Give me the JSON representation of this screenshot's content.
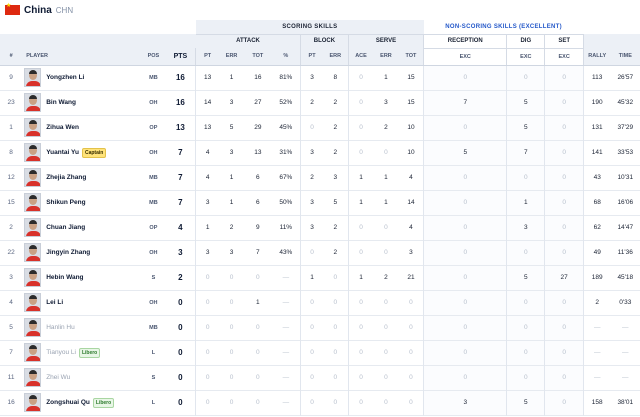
{
  "team": {
    "name": "China",
    "code": "CHN"
  },
  "headers": {
    "scoring": "SCORING SKILLS",
    "nonscoring": "NON-SCORING SKILLS (EXCELLENT)",
    "attack": "ATTACK",
    "block": "BLOCK",
    "serve": "SERVE",
    "reception": "RECEPTION",
    "dig": "DIG",
    "set": "SET",
    "num": "#",
    "player": "PLAYER",
    "pos": "POS",
    "pts": "PTS",
    "pt": "PT",
    "err": "ERR",
    "tot": "TOT",
    "pct": "%",
    "ace": "ACE",
    "exc": "EXC",
    "rally": "RALLY",
    "time": "TIME"
  },
  "players": [
    {
      "num": "9",
      "name": "Yongzhen Li",
      "badge": "",
      "pos": "MB",
      "pts": "16",
      "atk_pt": "13",
      "atk_err": "1",
      "atk_tot": "16",
      "atk_pct": "81%",
      "blk_pt": "3",
      "blk_err": "8",
      "srv_ace": "0",
      "srv_err": "1",
      "srv_tot": "15",
      "rec": "0",
      "dig": "0",
      "set": "0",
      "rally": "113",
      "time": "26'57",
      "active": true
    },
    {
      "num": "23",
      "name": "Bin Wang",
      "badge": "",
      "pos": "OH",
      "pts": "16",
      "atk_pt": "14",
      "atk_err": "3",
      "atk_tot": "27",
      "atk_pct": "52%",
      "blk_pt": "2",
      "blk_err": "2",
      "srv_ace": "0",
      "srv_err": "3",
      "srv_tot": "15",
      "rec": "7",
      "dig": "5",
      "set": "0",
      "rally": "190",
      "time": "45'32",
      "active": true
    },
    {
      "num": "1",
      "name": "Zihua Wen",
      "badge": "",
      "pos": "OP",
      "pts": "13",
      "atk_pt": "13",
      "atk_err": "5",
      "atk_tot": "29",
      "atk_pct": "45%",
      "blk_pt": "0",
      "blk_err": "2",
      "srv_ace": "0",
      "srv_err": "2",
      "srv_tot": "10",
      "rec": "0",
      "dig": "5",
      "set": "0",
      "rally": "131",
      "time": "37'29",
      "active": true
    },
    {
      "num": "8",
      "name": "Yuantai Yu",
      "badge": "Captain",
      "pos": "OH",
      "pts": "7",
      "atk_pt": "4",
      "atk_err": "3",
      "atk_tot": "13",
      "atk_pct": "31%",
      "blk_pt": "3",
      "blk_err": "2",
      "srv_ace": "0",
      "srv_err": "0",
      "srv_tot": "10",
      "rec": "5",
      "dig": "7",
      "set": "0",
      "rally": "141",
      "time": "33'53",
      "active": true
    },
    {
      "num": "12",
      "name": "Zhejia Zhang",
      "badge": "",
      "pos": "MB",
      "pts": "7",
      "atk_pt": "4",
      "atk_err": "1",
      "atk_tot": "6",
      "atk_pct": "67%",
      "blk_pt": "2",
      "blk_err": "3",
      "srv_ace": "1",
      "srv_err": "1",
      "srv_tot": "4",
      "rec": "0",
      "dig": "0",
      "set": "0",
      "rally": "43",
      "time": "10'31",
      "active": true
    },
    {
      "num": "15",
      "name": "Shikun Peng",
      "badge": "",
      "pos": "MB",
      "pts": "7",
      "atk_pt": "3",
      "atk_err": "1",
      "atk_tot": "6",
      "atk_pct": "50%",
      "blk_pt": "3",
      "blk_err": "5",
      "srv_ace": "1",
      "srv_err": "1",
      "srv_tot": "14",
      "rec": "0",
      "dig": "1",
      "set": "0",
      "rally": "68",
      "time": "16'06",
      "active": true
    },
    {
      "num": "2",
      "name": "Chuan Jiang",
      "badge": "",
      "pos": "OP",
      "pts": "4",
      "atk_pt": "1",
      "atk_err": "2",
      "atk_tot": "9",
      "atk_pct": "11%",
      "blk_pt": "3",
      "blk_err": "2",
      "srv_ace": "0",
      "srv_err": "0",
      "srv_tot": "4",
      "rec": "0",
      "dig": "3",
      "set": "0",
      "rally": "62",
      "time": "14'47",
      "active": true
    },
    {
      "num": "22",
      "name": "Jingyin Zhang",
      "badge": "",
      "pos": "OH",
      "pts": "3",
      "atk_pt": "3",
      "atk_err": "3",
      "atk_tot": "7",
      "atk_pct": "43%",
      "blk_pt": "0",
      "blk_err": "2",
      "srv_ace": "0",
      "srv_err": "0",
      "srv_tot": "3",
      "rec": "0",
      "dig": "0",
      "set": "0",
      "rally": "49",
      "time": "11'36",
      "active": true
    },
    {
      "num": "3",
      "name": "Hebin Wang",
      "badge": "",
      "pos": "S",
      "pts": "2",
      "atk_pt": "0",
      "atk_err": "0",
      "atk_tot": "0",
      "atk_pct": "—",
      "blk_pt": "1",
      "blk_err": "0",
      "srv_ace": "1",
      "srv_err": "2",
      "srv_tot": "21",
      "rec": "0",
      "dig": "5",
      "set": "27",
      "rally": "189",
      "time": "45'18",
      "active": true
    },
    {
      "num": "4",
      "name": "Lei Li",
      "badge": "",
      "pos": "OH",
      "pts": "0",
      "atk_pt": "0",
      "atk_err": "0",
      "atk_tot": "1",
      "atk_pct": "—",
      "blk_pt": "0",
      "blk_err": "0",
      "srv_ace": "0",
      "srv_err": "0",
      "srv_tot": "0",
      "rec": "0",
      "dig": "0",
      "set": "0",
      "rally": "2",
      "time": "0'33",
      "active": true
    },
    {
      "num": "5",
      "name": "Hanlin Hu",
      "badge": "",
      "pos": "MB",
      "pts": "0",
      "atk_pt": "0",
      "atk_err": "0",
      "atk_tot": "0",
      "atk_pct": "—",
      "blk_pt": "0",
      "blk_err": "0",
      "srv_ace": "0",
      "srv_err": "0",
      "srv_tot": "0",
      "rec": "0",
      "dig": "0",
      "set": "0",
      "rally": "—",
      "time": "—",
      "active": false
    },
    {
      "num": "7",
      "name": "Tianyou Li",
      "badge": "Libero",
      "pos": "L",
      "pts": "0",
      "atk_pt": "0",
      "atk_err": "0",
      "atk_tot": "0",
      "atk_pct": "—",
      "blk_pt": "0",
      "blk_err": "0",
      "srv_ace": "0",
      "srv_err": "0",
      "srv_tot": "0",
      "rec": "0",
      "dig": "0",
      "set": "0",
      "rally": "—",
      "time": "—",
      "active": false
    },
    {
      "num": "11",
      "name": "Zhei Wu",
      "badge": "",
      "pos": "S",
      "pts": "0",
      "atk_pt": "0",
      "atk_err": "0",
      "atk_tot": "0",
      "atk_pct": "—",
      "blk_pt": "0",
      "blk_err": "0",
      "srv_ace": "0",
      "srv_err": "0",
      "srv_tot": "0",
      "rec": "0",
      "dig": "0",
      "set": "0",
      "rally": "—",
      "time": "—",
      "active": false
    },
    {
      "num": "16",
      "name": "Zongshuai Qu",
      "badge": "Libero",
      "pos": "L",
      "pts": "0",
      "atk_pt": "0",
      "atk_err": "0",
      "atk_tot": "0",
      "atk_pct": "—",
      "blk_pt": "0",
      "blk_err": "0",
      "srv_ace": "0",
      "srv_err": "0",
      "srv_tot": "0",
      "rec": "3",
      "dig": "5",
      "set": "0",
      "rally": "158",
      "time": "38'01",
      "active": true
    }
  ]
}
